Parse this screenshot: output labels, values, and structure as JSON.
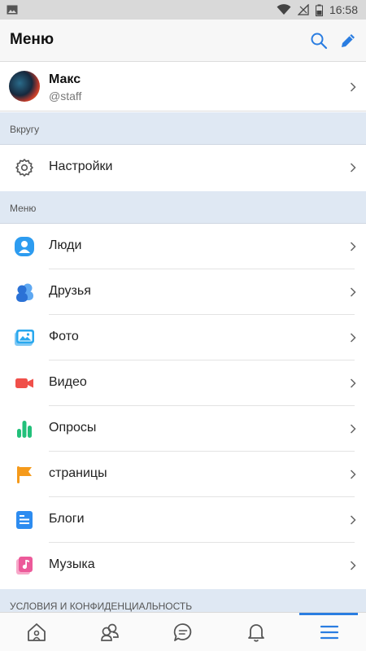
{
  "status_bar": {
    "time": "16:58"
  },
  "app_bar": {
    "title": "Меню"
  },
  "profile": {
    "name": "Макс",
    "handle": "@staff"
  },
  "section_nearby": {
    "label": "Вкругу"
  },
  "settings_row": {
    "label": "Настройки"
  },
  "section_menu": {
    "label": "Меню"
  },
  "menu_items": [
    {
      "label": "Люди",
      "icon": "people-icon",
      "color": "#2d9cf0"
    },
    {
      "label": "Друзья",
      "icon": "friends-icon",
      "color": "#2b72d6"
    },
    {
      "label": "Фото",
      "icon": "photo-icon",
      "color": "#29a8ee"
    },
    {
      "label": "Видео",
      "icon": "video-icon",
      "color": "#f0504a"
    },
    {
      "label": "Опросы",
      "icon": "polls-icon",
      "color": "#22c07a"
    },
    {
      "label": "страницы",
      "icon": "flag-icon",
      "color": "#f59a1b"
    },
    {
      "label": "Блоги",
      "icon": "blog-icon",
      "color": "#2d8cf0"
    },
    {
      "label": "Музыка",
      "icon": "music-icon",
      "color": "#ec5a9a"
    }
  ],
  "section_footer": {
    "label": "УСЛОВИЯ И КОНФИДЕНЦИАЛЬНОСТЬ"
  },
  "bottom_nav": [
    {
      "name": "home-icon"
    },
    {
      "name": "friends-icon"
    },
    {
      "name": "messages-icon"
    },
    {
      "name": "notifications-icon"
    },
    {
      "name": "menu-icon",
      "active": true
    }
  ],
  "colors": {
    "accent": "#2a7de1",
    "section_bg": "#dfe8f3"
  }
}
